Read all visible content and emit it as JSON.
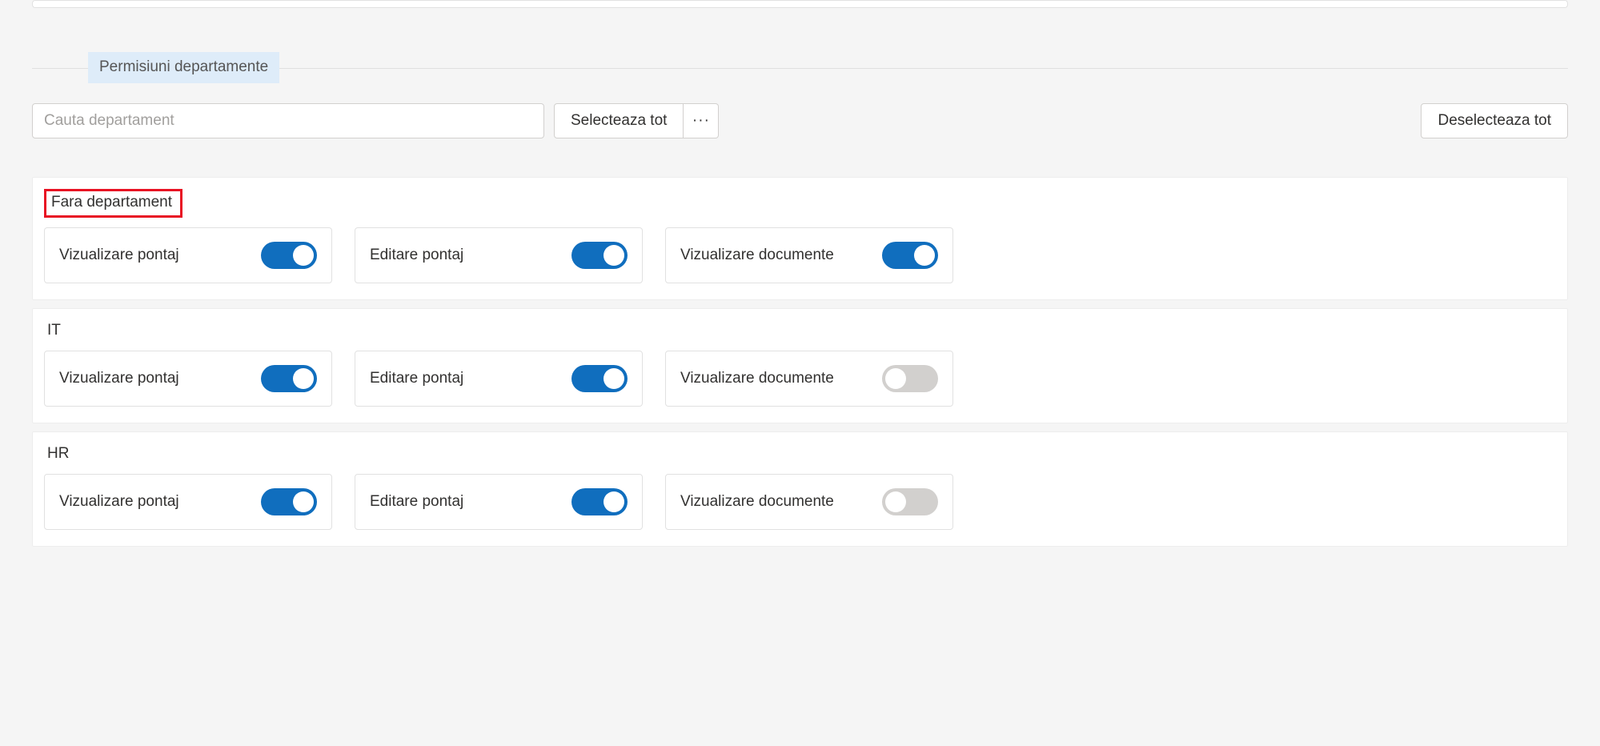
{
  "section": {
    "title": "Permisiuni departamente"
  },
  "toolbar": {
    "search_placeholder": "Cauta departament",
    "select_all_label": "Selecteaza tot",
    "more_label": "···",
    "deselect_all_label": "Deselecteaza tot"
  },
  "permission_labels": {
    "view_pontaj": "Vizualizare pontaj",
    "edit_pontaj": "Editare pontaj",
    "view_documents": "Vizualizare documente"
  },
  "departments": [
    {
      "name": "Fara departament",
      "highlighted": true,
      "permissions": {
        "view_pontaj": true,
        "edit_pontaj": true,
        "view_documents": true
      }
    },
    {
      "name": "IT",
      "highlighted": false,
      "permissions": {
        "view_pontaj": true,
        "edit_pontaj": true,
        "view_documents": false
      }
    },
    {
      "name": "HR",
      "highlighted": false,
      "permissions": {
        "view_pontaj": true,
        "edit_pontaj": true,
        "view_documents": false
      }
    }
  ]
}
